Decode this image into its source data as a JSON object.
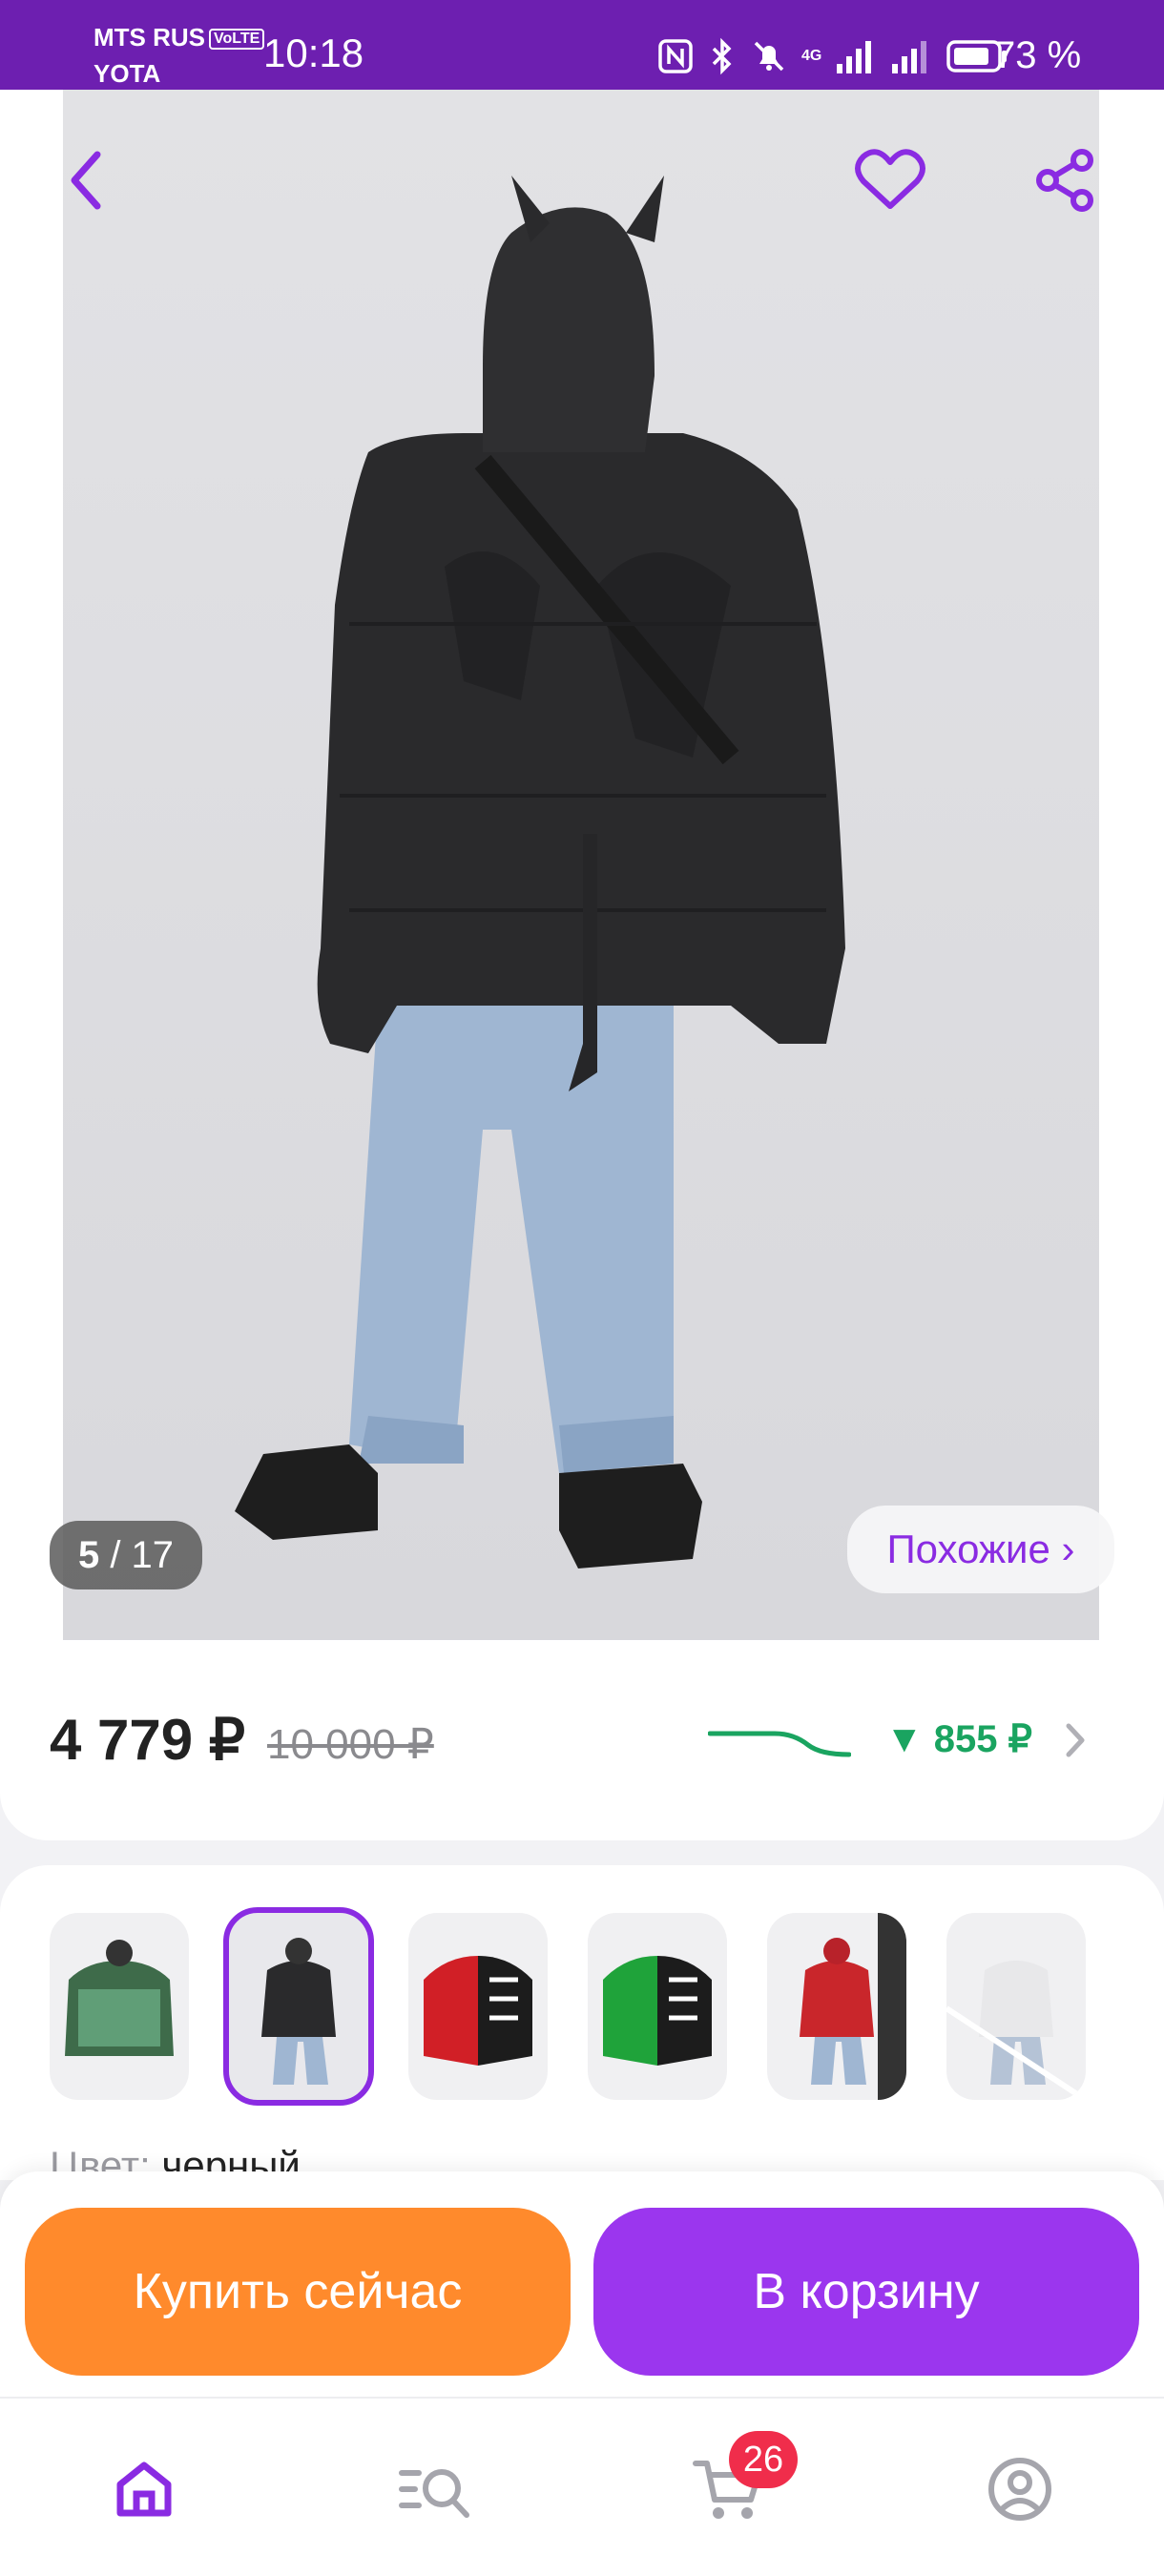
{
  "status_bar": {
    "carrier_1": "MTS RUS",
    "volte": "VoLTE",
    "carrier_2": "YOTA",
    "time": "10:18",
    "network": "4G",
    "battery": "73 %"
  },
  "gallery": {
    "counter_current": "5",
    "counter_total": "/ 17",
    "similar_label": "Похожие ›"
  },
  "price": {
    "current": "4 779 ₽",
    "old": "10 000 ₽",
    "drop": "▼ 855 ₽"
  },
  "variants": {
    "color_label": "Цвет:",
    "color_value": "черный",
    "selected_index": 1,
    "thumbs": [
      {
        "desc": "green camo puffer"
      },
      {
        "desc": "black devil puffer"
      },
      {
        "desc": "red-black skeleton puffer"
      },
      {
        "desc": "green-black skeleton puffer"
      },
      {
        "desc": "red devil puffer"
      },
      {
        "desc": "white skeleton puffer"
      }
    ]
  },
  "actions": {
    "buy_now": "Купить сейчас",
    "add_to_cart": "В корзину"
  },
  "nav": {
    "cart_count": "26"
  },
  "colors": {
    "brand_purple": "#9b36ee",
    "buy_orange": "#ff8a2c",
    "price_drop_green": "#1aa460",
    "badge_red": "#f02d4b"
  }
}
